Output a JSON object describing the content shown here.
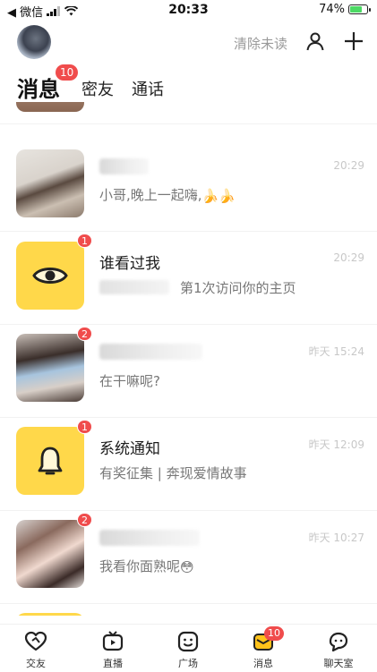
{
  "status_bar": {
    "back_label": "◀ 微信",
    "time": "20:33",
    "battery": "74%",
    "battery_level": 0.74
  },
  "header": {
    "clear_unread": "清除未读"
  },
  "tabs": {
    "messages": "消息",
    "messages_badge": "10",
    "friends": "密友",
    "calls": "通话"
  },
  "conversations": [
    {
      "avatar": "photo-woman-long-hair",
      "name": "",
      "preview": "小哥,晚上一起嗨,",
      "preview_emoji": "🍌🍌",
      "time": "20:29",
      "badge": ""
    },
    {
      "avatar": "eye-icon",
      "name": "谁看过我",
      "preview": "第1次访问你的主页",
      "time": "20:29",
      "badge": "1"
    },
    {
      "avatar": "photo-woman-mask",
      "name": "",
      "preview": "在干嘛呢?",
      "time": "昨天 15:24",
      "badge": "2"
    },
    {
      "avatar": "bell-icon",
      "name": "系统通知",
      "preview": "有奖征集 | 奔现爱情故事",
      "time": "昨天 12:09",
      "badge": "1"
    },
    {
      "avatar": "photo-woman-selfie",
      "name": "",
      "preview": "我看你面熟呢",
      "preview_emoji": "😳",
      "time": "昨天 10:27",
      "badge": "2"
    }
  ],
  "bottom_nav": {
    "items": [
      {
        "label": "交友",
        "icon": "heart-icon"
      },
      {
        "label": "直播",
        "icon": "tv-icon"
      },
      {
        "label": "广场",
        "icon": "smiley-icon"
      },
      {
        "label": "消息",
        "icon": "message-icon",
        "badge": "10"
      },
      {
        "label": "聊天室",
        "icon": "chat-bubbles-icon"
      }
    ]
  },
  "colors": {
    "accent_yellow": "#ffd84a",
    "badge_red": "#f04c4c",
    "active_nav": "#ffc21a"
  }
}
